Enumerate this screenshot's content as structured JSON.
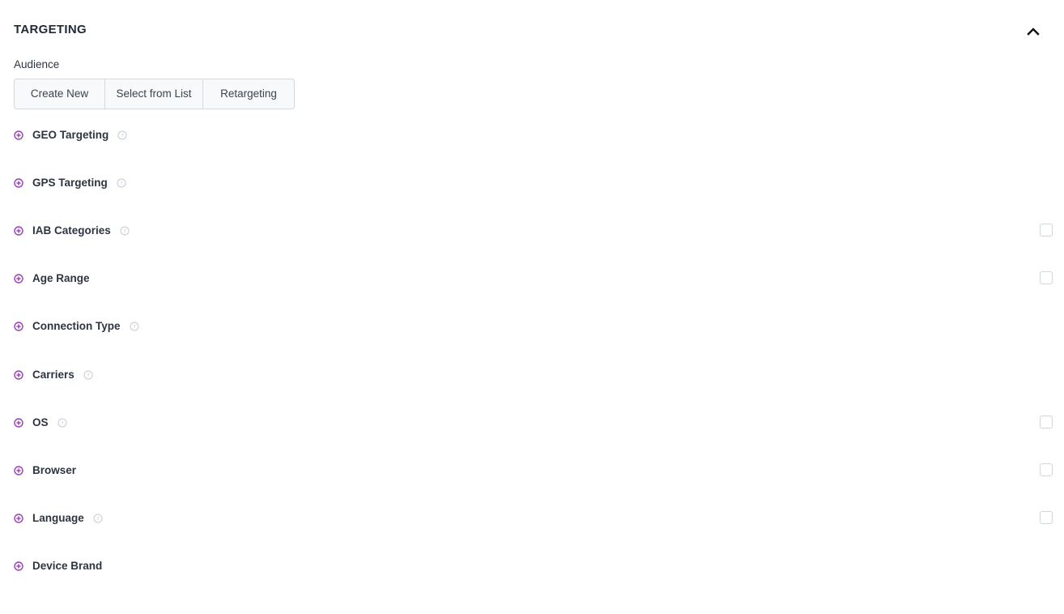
{
  "section": {
    "title": "TARGETING",
    "collapse_icon": "chevron-up-icon"
  },
  "audience": {
    "label": "Audience",
    "buttons": [
      "Create New",
      "Select from List",
      "Retargeting"
    ]
  },
  "rows": [
    {
      "label": "GEO Targeting",
      "has_help": true,
      "has_checkbox": false
    },
    {
      "label": "GPS Targeting",
      "has_help": true,
      "has_checkbox": false
    },
    {
      "label": "IAB Categories",
      "has_help": true,
      "has_checkbox": true
    },
    {
      "label": "Age Range",
      "has_help": false,
      "has_checkbox": true
    },
    {
      "label": "Connection Type",
      "has_help": true,
      "has_checkbox": false
    },
    {
      "label": "Carriers",
      "has_help": true,
      "has_checkbox": false
    },
    {
      "label": "OS",
      "has_help": true,
      "has_checkbox": true
    },
    {
      "label": "Browser",
      "has_help": false,
      "has_checkbox": true
    },
    {
      "label": "Language",
      "has_help": true,
      "has_checkbox": true
    },
    {
      "label": "Device Brand",
      "has_help": false,
      "has_checkbox": false
    }
  ],
  "colors": {
    "accent": "#9b3fb5",
    "help": "#c5cad3",
    "text": "#2d3540"
  },
  "icons": {
    "row_expand": "plus-circle-icon",
    "help": "question-circle-icon"
  }
}
